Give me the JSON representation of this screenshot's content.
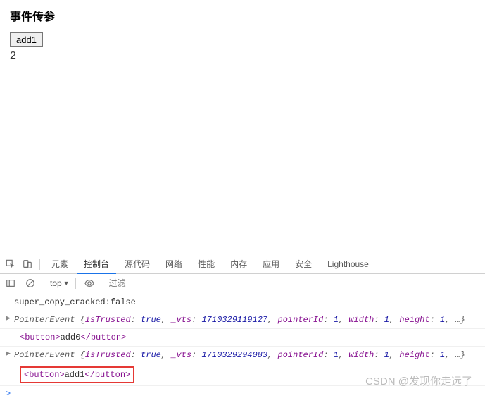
{
  "page": {
    "title": "事件传参",
    "button_label": "add1",
    "number": "2"
  },
  "devtools": {
    "tabs": [
      "元素",
      "控制台",
      "源代码",
      "网络",
      "性能",
      "内存",
      "应用",
      "安全",
      "Lighthouse"
    ],
    "active_tab": "控制台",
    "context": "top",
    "filter_placeholder": "过滤"
  },
  "console": {
    "line0": "super_copy_cracked:false",
    "pe1": {
      "label": "PointerEvent ",
      "open": "{",
      "k1": "isTrusted",
      "v1": "true",
      "k2": "_vts",
      "v2": "1710329119127",
      "k3": "pointerId",
      "v3": "1",
      "k4": "width",
      "v4": "1",
      "k5": "height",
      "v5": "1",
      "rest": ", …}"
    },
    "btn1": {
      "open": "<button>",
      "text": "add0",
      "close": "</button>"
    },
    "pe2": {
      "label": "PointerEvent ",
      "open": "{",
      "k1": "isTrusted",
      "v1": "true",
      "k2": "_vts",
      "v2": "1710329294083",
      "k3": "pointerId",
      "v3": "1",
      "k4": "width",
      "v4": "1",
      "k5": "height",
      "v5": "1",
      "rest": ", …}"
    },
    "btn2": {
      "open": "<button>",
      "text": "add1",
      "close": "</button>"
    },
    "prompt": ">"
  },
  "watermark": "CSDN @发现你走远了"
}
